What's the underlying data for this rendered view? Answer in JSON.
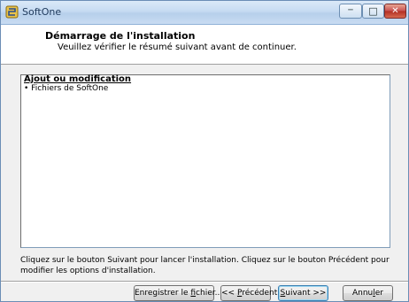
{
  "window": {
    "title": "SoftOne",
    "accent_color": "#c6dbf2"
  },
  "title_controls": {
    "minimize": "─",
    "maximize": "□",
    "close": "✕"
  },
  "header": {
    "title": "Démarrage de l'installation",
    "subtitle": "Veuillez vérifier le résumé suivant avant de continuer."
  },
  "summary": {
    "heading": "Ajout ou modification",
    "items": [
      "• Fichiers de SoftOne"
    ]
  },
  "instructions": "Cliquez sur le bouton Suivant pour lancer l'installation.  Cliquez sur le bouton Précédent pour modifier les options d'installation.",
  "buttons": {
    "save_prefix": "Enregistrer le ",
    "save_accel": "f",
    "save_suffix": "ichier...",
    "prev_prefix": "<< ",
    "prev_accel": "P",
    "prev_suffix": "récédent",
    "next_accel": "S",
    "next_suffix": "uivant >>",
    "cancel_prefix": "Annu",
    "cancel_accel": "l",
    "cancel_suffix": "er"
  }
}
